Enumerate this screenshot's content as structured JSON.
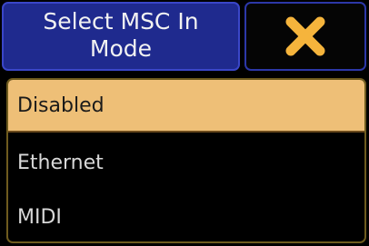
{
  "dialog": {
    "title": "Select MSC In\nMode",
    "close_icon": "close-x-icon",
    "close_color": "#f5b43c"
  },
  "options": [
    {
      "label": "Disabled",
      "selected": true
    },
    {
      "label": "Ethernet",
      "selected": false
    },
    {
      "label": "MIDI",
      "selected": false
    }
  ],
  "colors": {
    "title_bg": "#1f2a8e",
    "title_border": "#3a46c8",
    "selected_bg": "#eebf77",
    "list_border": "#6e5b1e",
    "background": "#000000"
  }
}
